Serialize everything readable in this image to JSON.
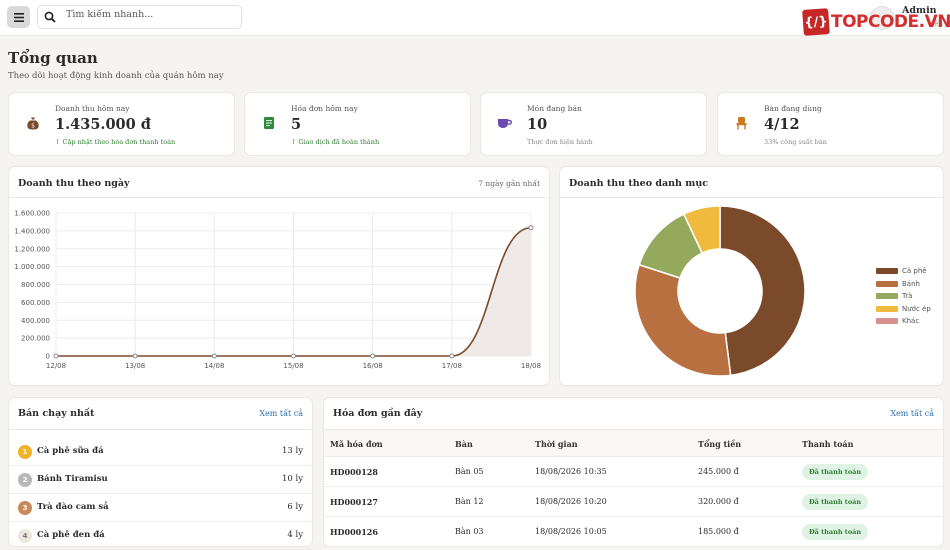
{
  "topbar": {
    "search_placeholder": "Tìm kiếm nhanh...",
    "logo_mark": "{/}",
    "logo_text": "TOPCODE.VN",
    "admin_name": "Admin",
    "admin_role": "viên"
  },
  "page": {
    "title": "Tổng quan",
    "subtitle": "Theo dõi hoạt động kinh doanh của quán hôm nay"
  },
  "stats": [
    {
      "label": "Doanh thu hôm nay",
      "value": "1.435.000 đ",
      "note": "↑ Cập nhật theo hóa đơn thanh toán",
      "icon": "money-bag-icon",
      "icon_bg": "#f5e6dc",
      "icon_color": "#7a4a2a",
      "note_color": "green"
    },
    {
      "label": "Hóa đơn hôm nay",
      "value": "5",
      "note": "↑ Giao dịch đã hoàn thành",
      "icon": "receipt-icon",
      "icon_bg": "#dcefe0",
      "icon_color": "#2e8b3e",
      "note_color": "green"
    },
    {
      "label": "Món đang bán",
      "value": "10",
      "note": "Thực đơn hiện hành",
      "icon": "coffee-cup-icon",
      "icon_bg": "#ebe3f5",
      "icon_color": "#6a4bb0",
      "note_color": "gray"
    },
    {
      "label": "Bàn đang dùng",
      "value": "4/12",
      "note": "33% công suất bàn",
      "icon": "chair-icon",
      "icon_bg": "#fbecd9",
      "icon_color": "#c87b22",
      "note_color": "gray"
    }
  ],
  "revenue_panel": {
    "title": "Doanh thu theo ngày",
    "hint": "7 ngày gần nhất"
  },
  "category_panel": {
    "title": "Doanh thu theo danh mục"
  },
  "chart_data": [
    {
      "type": "area",
      "title": "Doanh thu theo ngày",
      "categories": [
        "12/08",
        "13/08",
        "14/08",
        "15/08",
        "16/08",
        "17/08",
        "18/08"
      ],
      "values": [
        0,
        0,
        0,
        0,
        0,
        0,
        1435000
      ],
      "ylim": [
        0,
        1600000
      ],
      "yticks": [
        "0",
        "200.000",
        "400.000",
        "600.000",
        "800.000",
        "1.000.000",
        "1.200.000",
        "1.400.000",
        "1.600.000"
      ],
      "grid": true,
      "line_color": "#7a4a2a",
      "fill_color": "#efe9e7"
    },
    {
      "type": "pie",
      "donut": true,
      "title": "Doanh thu theo danh mục",
      "labels": [
        "Cà phê",
        "Bánh",
        "Trà",
        "Nước ép",
        "Khác"
      ],
      "values": [
        48,
        32,
        13,
        7,
        0
      ],
      "colors": [
        "#7a4a2a",
        "#b87040",
        "#95a95c",
        "#efba3e",
        "#d99190"
      ],
      "legend": "right"
    }
  ],
  "best_sellers": {
    "title": "Bán chạy nhất",
    "link": "Xem tất cả",
    "items": [
      {
        "rank": "1",
        "name": "Cà phê sữa đá",
        "qty": "13 ly",
        "color": "#f0b429"
      },
      {
        "rank": "2",
        "name": "Bánh Tiramisu",
        "qty": "10 ly",
        "color": "#b8b8b8"
      },
      {
        "rank": "3",
        "name": "Trà đào cam sả",
        "qty": "6 ly",
        "color": "#c98a5a"
      },
      {
        "rank": "4",
        "name": "Cà phê đen đá",
        "qty": "4 ly",
        "color": "#e6e0d8"
      }
    ]
  },
  "recent_invoices": {
    "title": "Hóa đơn gần đây",
    "link": "Xem tất cả",
    "columns": [
      "Mã hóa đơn",
      "Bàn",
      "Thời gian",
      "Tổng tiền",
      "Thanh toán"
    ],
    "rows": [
      {
        "code": "HD000128",
        "table": "Bàn 05",
        "time": "18/08/2026 10:35",
        "total": "245.000 đ",
        "status": "Đã thanh toán"
      },
      {
        "code": "HD000127",
        "table": "Bàn 12",
        "time": "18/08/2026 10:20",
        "total": "320.000 đ",
        "status": "Đã thanh toán"
      },
      {
        "code": "HD000126",
        "table": "Bàn 03",
        "time": "18/08/2026 10:05",
        "total": "185.000 đ",
        "status": "Đã thanh toán"
      }
    ]
  }
}
